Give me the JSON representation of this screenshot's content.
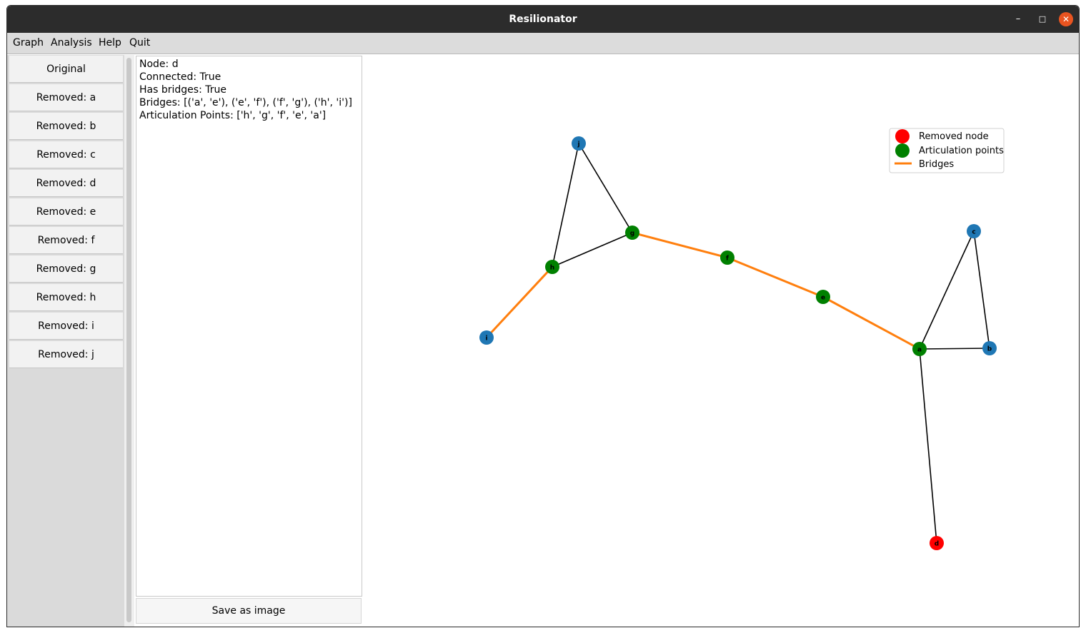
{
  "window": {
    "title": "Resilionator",
    "controls": {
      "minimize": "–",
      "maximize": "□",
      "close": "✕"
    }
  },
  "menubar": {
    "items": [
      "Graph",
      "Analysis",
      "Help",
      "Quit"
    ]
  },
  "sidebar": {
    "items": [
      "Original",
      "Removed: a",
      "Removed: b",
      "Removed: c",
      "Removed: d",
      "Removed: e",
      "Removed: f",
      "Removed: g",
      "Removed: h",
      "Removed: i",
      "Removed: j"
    ]
  },
  "info": {
    "lines": [
      "Node: d",
      "Connected: True",
      "Has bridges: True",
      "Bridges: [('a', 'e'), ('e', 'f'), ('f', 'g'), ('h', 'i')]",
      "Articulation Points: ['h', 'g', 'f', 'e', 'a']"
    ]
  },
  "save_button": "Save as image",
  "graph": {
    "colors": {
      "normal": "#1f77b4",
      "articulation": "#008000",
      "removed": "#ff0000",
      "bridge": "#ff7f0e",
      "edge": "#000000"
    },
    "legend": {
      "removed": "Removed node",
      "articulation": "Articulation points",
      "bridges": "Bridges"
    },
    "nodes": [
      {
        "id": "j",
        "kind": "normal"
      },
      {
        "id": "g",
        "kind": "articulation"
      },
      {
        "id": "h",
        "kind": "articulation"
      },
      {
        "id": "f",
        "kind": "articulation"
      },
      {
        "id": "e",
        "kind": "articulation"
      },
      {
        "id": "i",
        "kind": "normal"
      },
      {
        "id": "c",
        "kind": "normal"
      },
      {
        "id": "a",
        "kind": "articulation"
      },
      {
        "id": "b",
        "kind": "normal"
      },
      {
        "id": "d",
        "kind": "removed"
      }
    ],
    "edges": [
      [
        "j",
        "h",
        "normal"
      ],
      [
        "j",
        "g",
        "normal"
      ],
      [
        "h",
        "g",
        "normal"
      ],
      [
        "h",
        "i",
        "bridge"
      ],
      [
        "g",
        "f",
        "bridge"
      ],
      [
        "f",
        "e",
        "bridge"
      ],
      [
        "e",
        "a",
        "bridge"
      ],
      [
        "a",
        "c",
        "normal"
      ],
      [
        "c",
        "b",
        "normal"
      ],
      [
        "a",
        "b",
        "normal"
      ],
      [
        "a",
        "d",
        "normal"
      ]
    ]
  }
}
